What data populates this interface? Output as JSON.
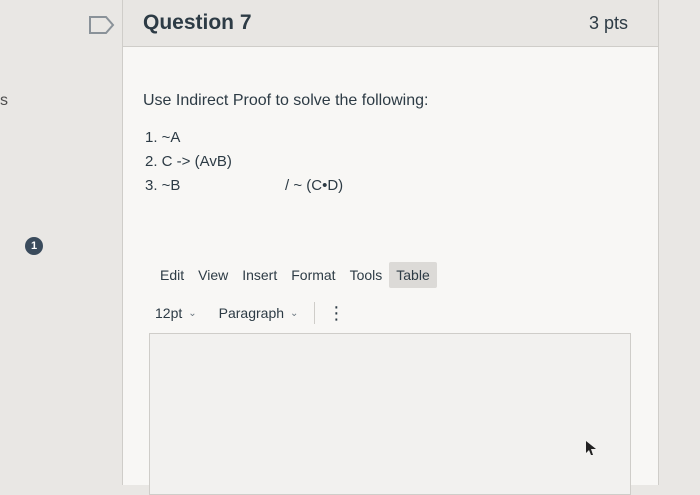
{
  "edge": {
    "left_text": "s",
    "step_badge": "1"
  },
  "question": {
    "title": "Question 7",
    "points": "3 pts",
    "prompt": "Use Indirect Proof to solve the following:",
    "premises": [
      "1. ~A",
      "2. C -> (AvB)",
      "3. ~B"
    ],
    "conclusion": "/ ~ (C•D)"
  },
  "editor": {
    "menu": [
      "Edit",
      "View",
      "Insert",
      "Format",
      "Tools",
      "Table"
    ],
    "active_menu": "Table",
    "font_size": "12pt",
    "block_format": "Paragraph"
  },
  "icons": {
    "flag": "flag-outline-icon",
    "toolbar_more": "more-vertical-icon",
    "cursor": "mouse-cursor-icon"
  },
  "colors": {
    "badge": "#3a4b5c",
    "header_bg": "#e8e6e3",
    "text": "#2d3b45"
  }
}
